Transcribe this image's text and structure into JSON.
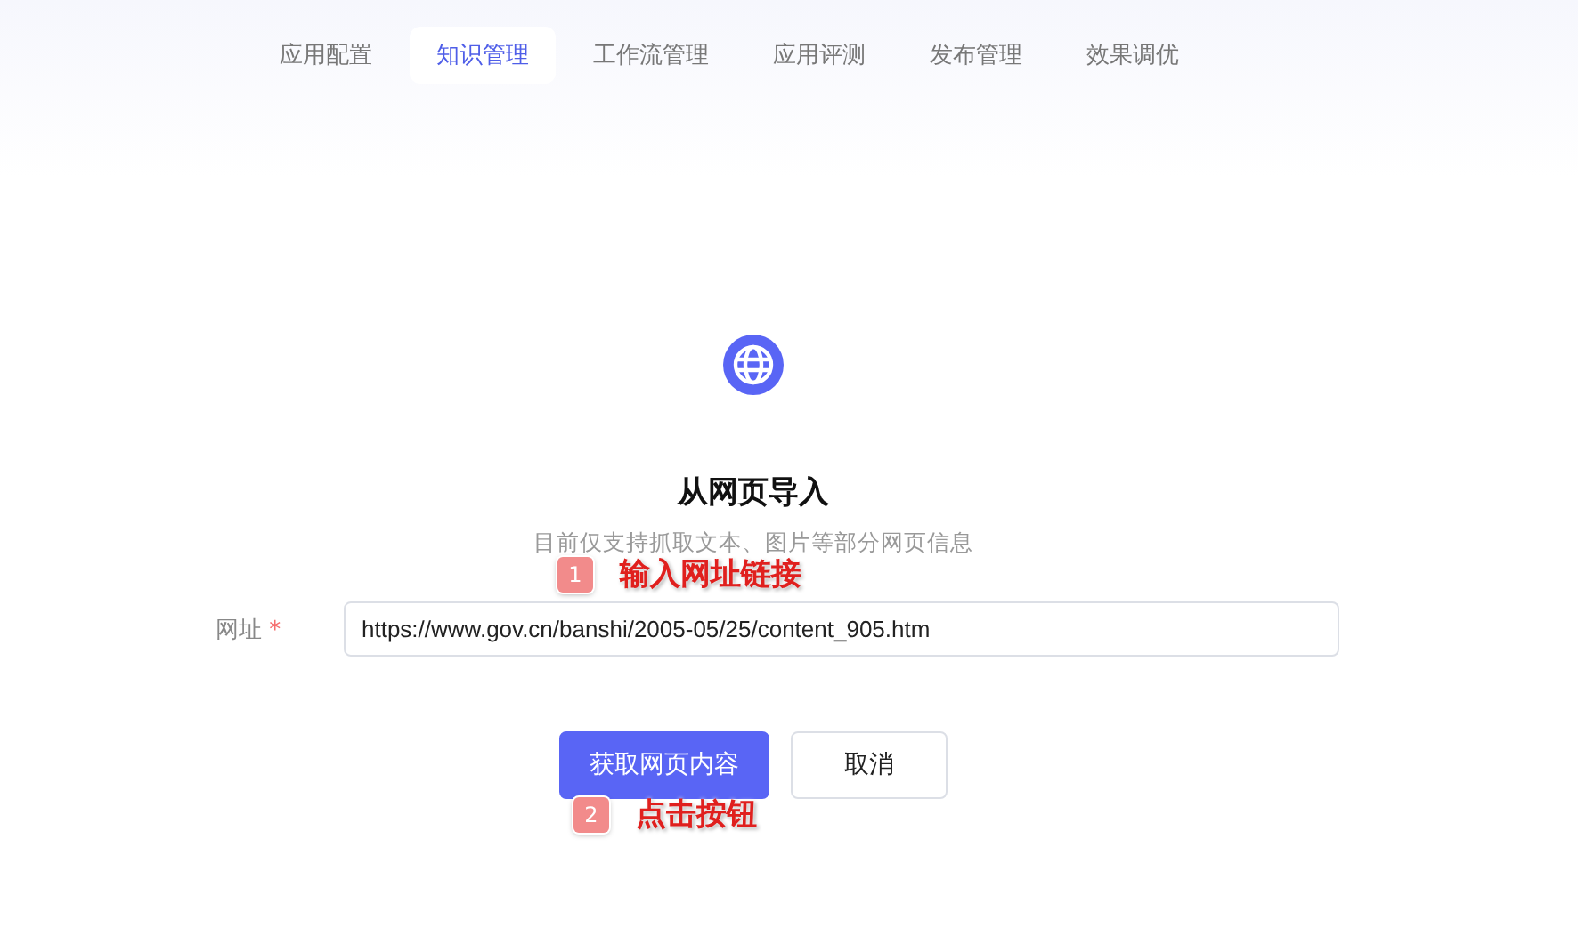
{
  "tabs": [
    {
      "label": "应用配置",
      "selected": false
    },
    {
      "label": "知识管理",
      "selected": true
    },
    {
      "label": "工作流管理",
      "selected": false
    },
    {
      "label": "应用评测",
      "selected": false
    },
    {
      "label": "发布管理",
      "selected": false
    },
    {
      "label": "效果调优",
      "selected": false
    }
  ],
  "import_panel": {
    "title": "从网页导入",
    "subtitle": "目前仅支持抓取文本、图片等部分网页信息",
    "url_field": {
      "label": "网址",
      "required_mark": "*",
      "value": "https://www.gov.cn/banshi/2005-05/25/content_905.htm"
    },
    "buttons": [
      {
        "label": "获取网页内容",
        "kind": "primary"
      },
      {
        "label": "取消",
        "kind": "secondary"
      }
    ]
  },
  "annotations": [
    {
      "number": "1",
      "text": "输入网址链接"
    },
    {
      "number": "2",
      "text": "点击按钮"
    }
  ]
}
